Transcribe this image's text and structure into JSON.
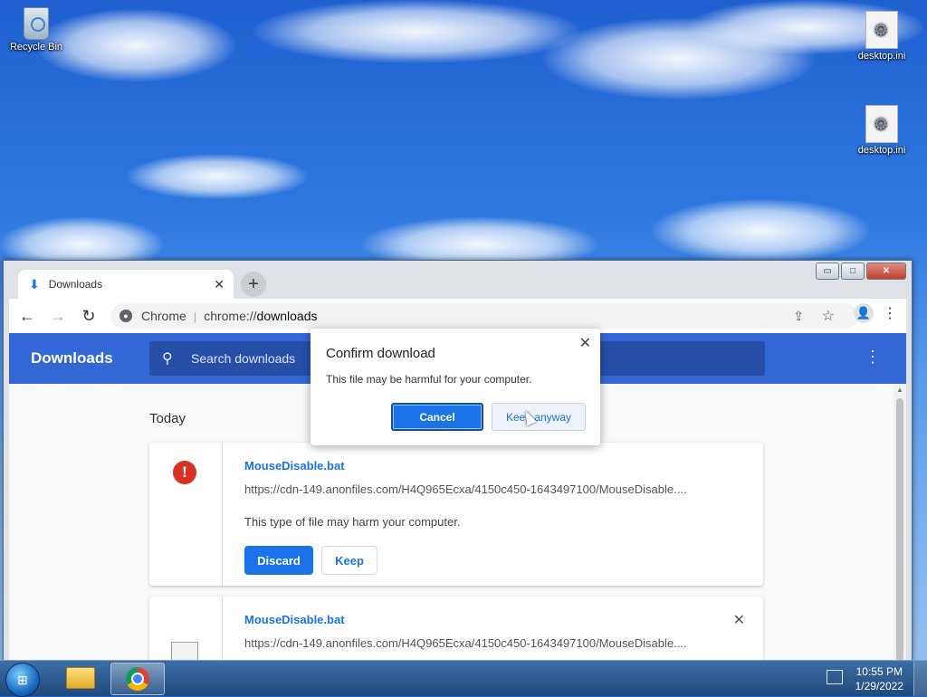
{
  "desktop": {
    "icons": [
      {
        "label": "Recycle Bin"
      },
      {
        "label": "desktop.ini"
      },
      {
        "label": "desktop.ini"
      }
    ]
  },
  "window": {
    "controls": {
      "minimize": "▭",
      "maximize": "□",
      "close": "✕"
    }
  },
  "browser": {
    "tab": {
      "title": "Downloads",
      "close": "✕"
    },
    "new_tab": "+",
    "toolbar": {
      "back": "←",
      "forward": "→",
      "reload": "↻",
      "chip": "Chrome",
      "url_scheme": "chrome://",
      "url_host": "downloads"
    }
  },
  "downloads_page": {
    "header_title": "Downloads",
    "search_placeholder": "Search downloads",
    "section_date": "Today",
    "items": [
      {
        "file_name": "MouseDisable.bat",
        "url": "https://cdn-149.anonfiles.com/H4Q965Ecxa/4150c450-1643497100/MouseDisable....",
        "warning": "This type of file may harm your computer.",
        "discard_label": "Discard",
        "keep_label": "Keep"
      },
      {
        "file_name": "MouseDisable.bat",
        "url": "https://cdn-149.anonfiles.com/H4Q965Ecxa/4150c450-1643497100/MouseDisable...."
      }
    ]
  },
  "dialog": {
    "title": "Confirm download",
    "message": "This file may be harmful for your computer.",
    "cancel_label": "Cancel",
    "keep_anyway_label": "Keep anyway"
  },
  "taskbar": {
    "time": "10:55 PM",
    "date": "1/29/2022"
  }
}
